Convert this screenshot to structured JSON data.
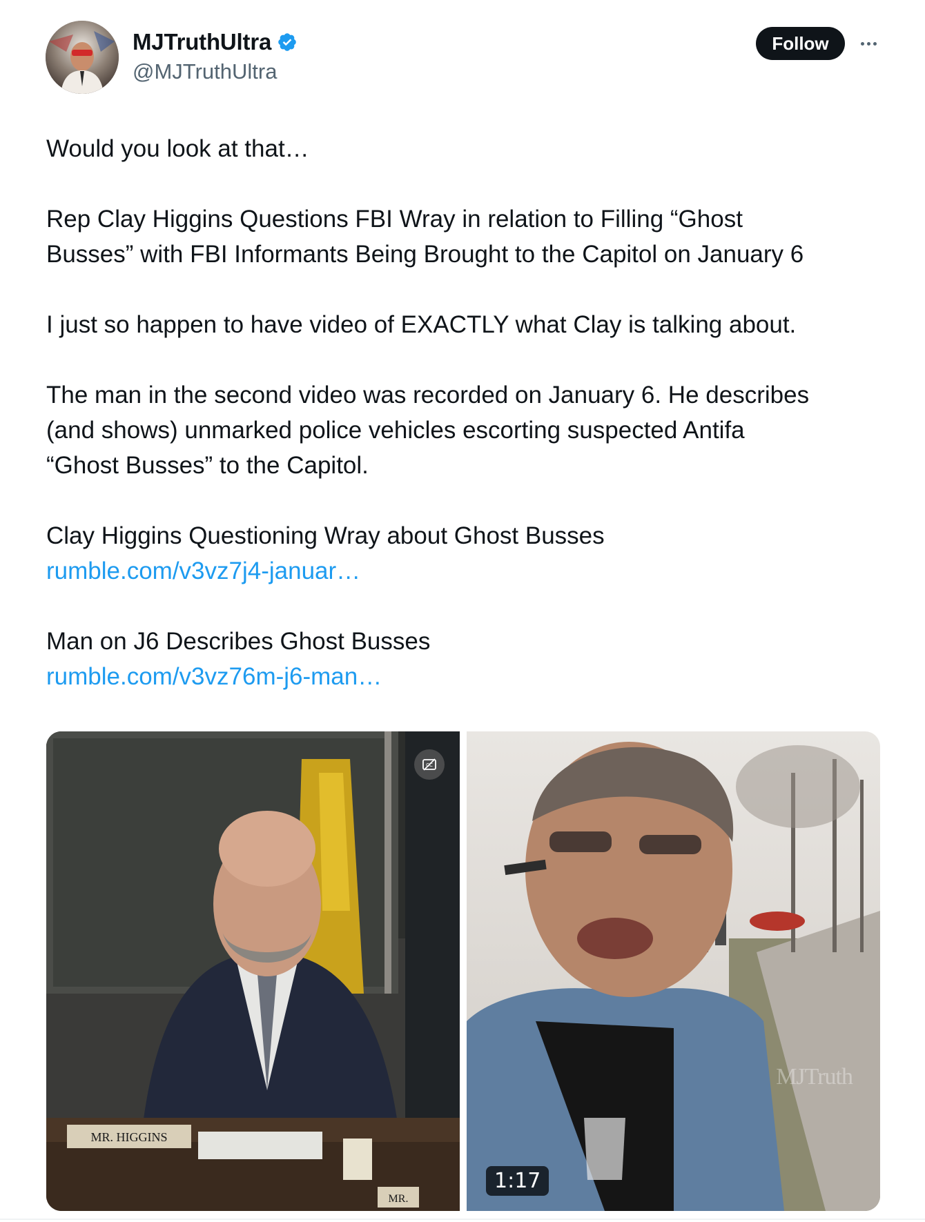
{
  "author": {
    "display_name": "MJTruthUltra",
    "handle": "@MJTruthUltra",
    "verified": true,
    "verified_color": "#1d9bf0"
  },
  "actions": {
    "follow_label": "Follow",
    "more_icon": "more-horizontal-icon"
  },
  "tweet": {
    "paragraphs": [
      {
        "lines": [
          "Would you look at that…"
        ]
      },
      {
        "lines": [
          "Rep Clay Higgins Questions FBI Wray in relation to Filling “Ghost",
          "Busses” with FBI Informants Being Brought to the Capitol on January 6"
        ]
      },
      {
        "lines": [
          "I just so happen to have video of EXACTLY what Clay is talking about."
        ]
      },
      {
        "lines": [
          "The man in the second video was recorded on January 6. He describes",
          "(and shows) unmarked police vehicles escorting suspected Antifa",
          "“Ghost Busses” to the Capitol."
        ]
      },
      {
        "lines": [
          "Clay Higgins Questioning Wray about Ghost Busses"
        ],
        "link": "rumble.com/v3vz7j4-januar…"
      },
      {
        "lines": [
          "Man on J6 Describes Ghost Busses"
        ],
        "link": "rumble.com/v3vz76m-j6-man…"
      }
    ],
    "link_color": "#1d9bf0"
  },
  "media": {
    "left": {
      "nameplate": "MR. HIGGINS",
      "nameplate_right": "MR.",
      "badge_icon": "captions-off-icon"
    },
    "right": {
      "duration": "1:17",
      "watermark": "MJTruth"
    }
  }
}
